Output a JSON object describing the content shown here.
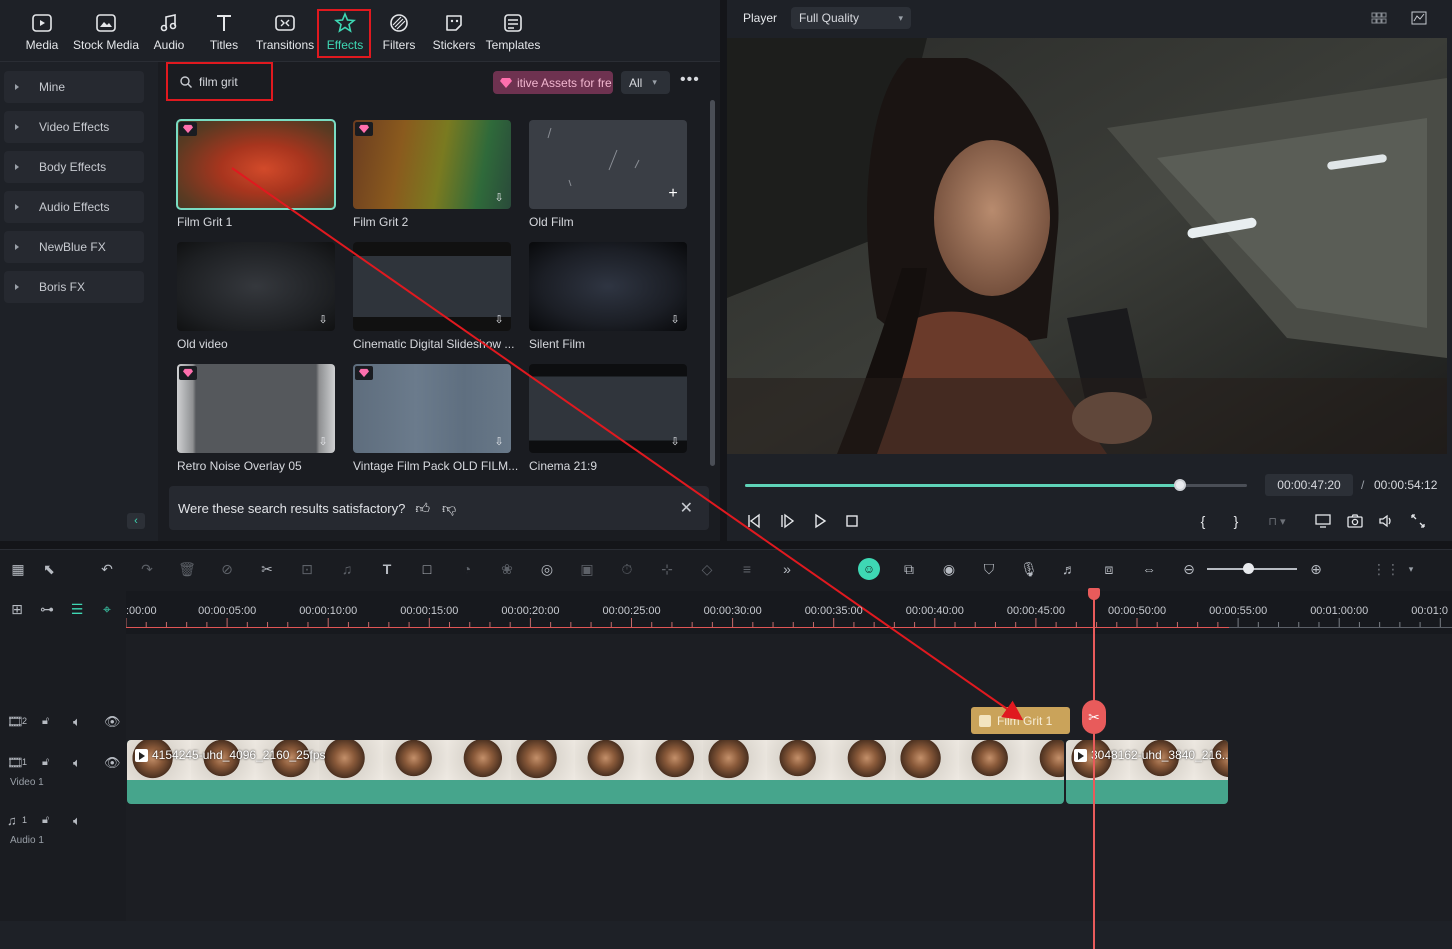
{
  "top_tabs": [
    {
      "label": "Media",
      "icon": "media-icon"
    },
    {
      "label": "Stock Media",
      "icon": "stock-media-icon"
    },
    {
      "label": "Audio",
      "icon": "music-note-icon"
    },
    {
      "label": "Titles",
      "icon": "titles-t-icon"
    },
    {
      "label": "Transitions",
      "icon": "transitions-icon"
    },
    {
      "label": "Effects",
      "icon": "effects-star-icon",
      "active": true
    },
    {
      "label": "Filters",
      "icon": "filters-icon"
    },
    {
      "label": "Stickers",
      "icon": "stickers-icon"
    },
    {
      "label": "Templates",
      "icon": "templates-icon"
    }
  ],
  "sidebar": {
    "items": [
      "Mine",
      "Video Effects",
      "Body Effects",
      "Audio Effects",
      "NewBlue FX",
      "Boris FX"
    ]
  },
  "search": {
    "value": "film grit"
  },
  "promo_label": "itive Assets for fre",
  "filter_value": "All",
  "more_label": "•••",
  "effects": [
    {
      "label": "Film Grit 1",
      "premium": true,
      "selected": true
    },
    {
      "label": "Film Grit 2",
      "premium": true,
      "download": true
    },
    {
      "label": "Old Film",
      "add": true
    },
    {
      "label": "Old video",
      "download": true
    },
    {
      "label": "Cinematic Digital Slideshow ...",
      "download": true
    },
    {
      "label": "Silent Film",
      "download": true
    },
    {
      "label": "Retro Noise Overlay 05",
      "premium": true,
      "download": true
    },
    {
      "label": "Vintage Film Pack OLD FILM...",
      "premium": true,
      "download": true
    },
    {
      "label": "Cinema 21:9",
      "download": true
    }
  ],
  "feedback": {
    "text": "Were these search results satisfactory?"
  },
  "player": {
    "title": "Player",
    "quality": "Full Quality",
    "current_time": "00:00:47:20",
    "separator": "/",
    "total_time": "00:00:54:12",
    "progress": 0.866
  },
  "ruler_ticks": [
    ":00:00",
    "00:00:05:00",
    "00:00:10:00",
    "00:00:15:00",
    "00:00:20:00",
    "00:00:25:00",
    "00:00:30:00",
    "00:00:35:00",
    "00:00:40:00",
    "00:00:45:00",
    "00:00:50:00",
    "00:00:55:00",
    "00:01:00:00",
    "00:01:0"
  ],
  "tracks": {
    "video2_num": "2",
    "video1_num": "1",
    "video1_label": "Video 1",
    "audio1_num": "1",
    "audio1_label": "Audio 1"
  },
  "clips": {
    "effect": "Film Grit 1",
    "video_a": "4154245-uhd_4096_2160_25fps",
    "video_b": "3048162-uhd_3840_216..."
  },
  "colors": {
    "accent": "#3ed8b4",
    "highlight": "#e0191f",
    "playhead": "#e85b5b",
    "clip": "#46a58c",
    "effect_clip": "#caa35a"
  }
}
